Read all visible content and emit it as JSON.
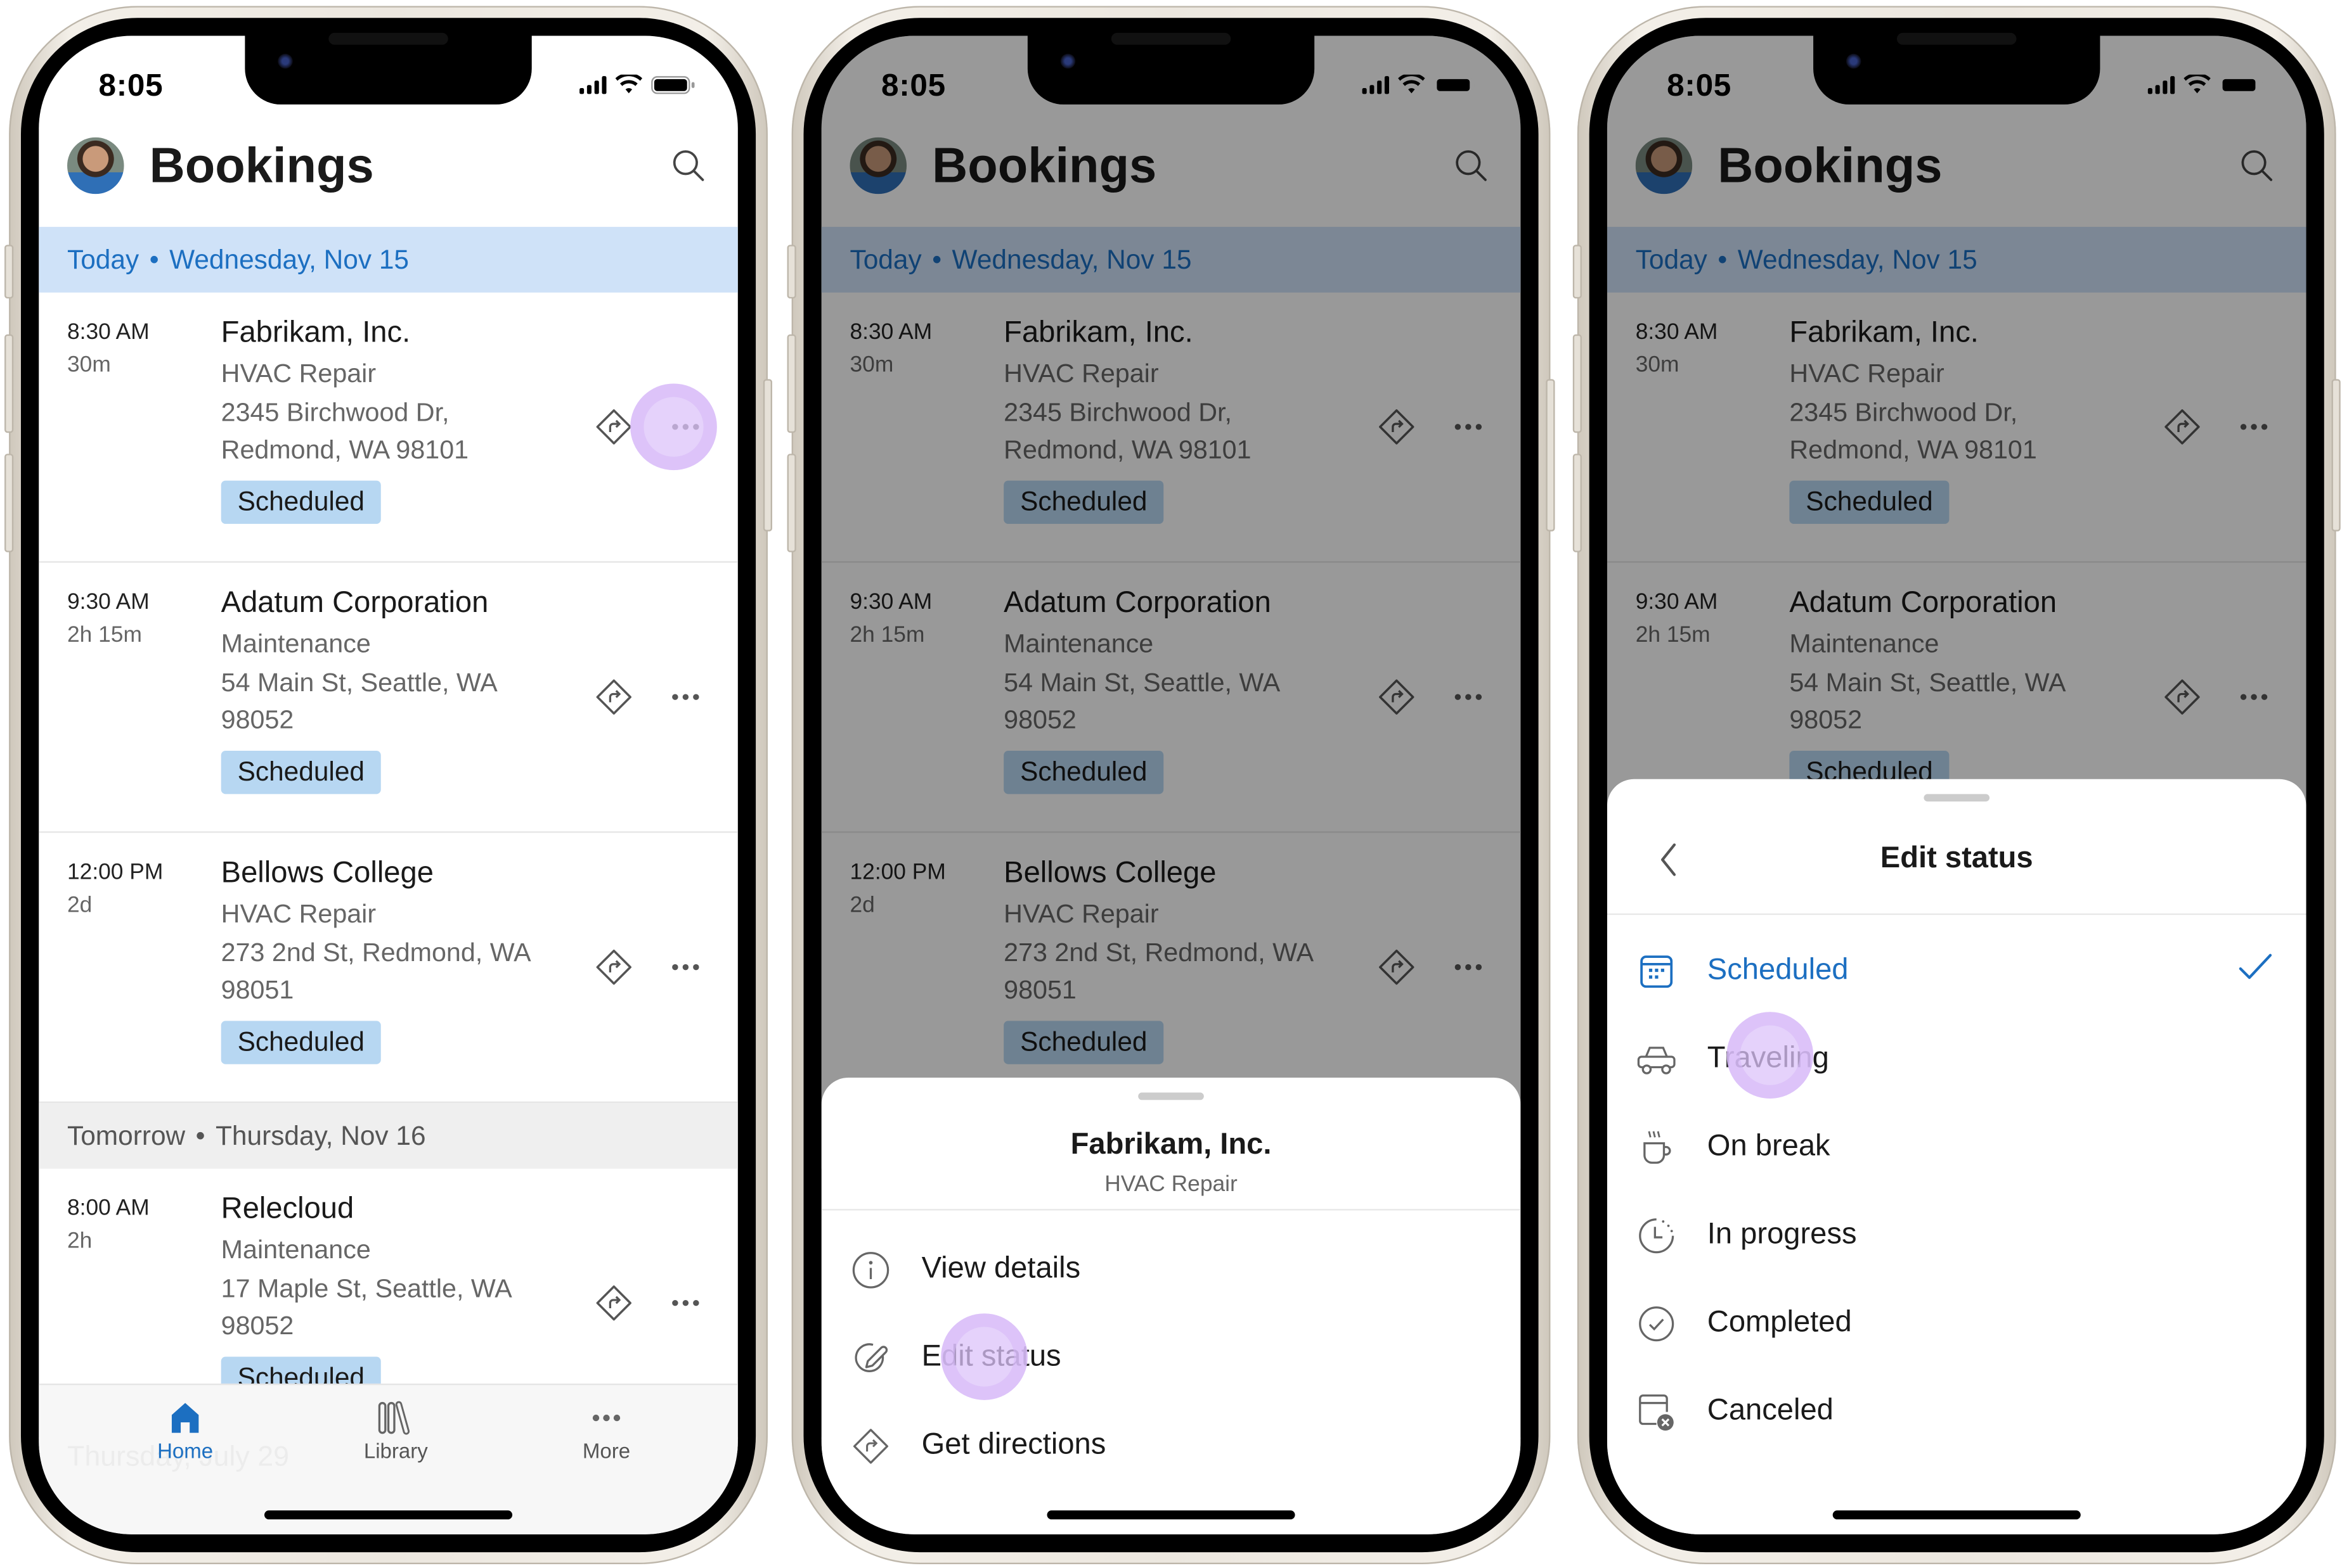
{
  "statusbar": {
    "time": "8:05"
  },
  "app": {
    "title": "Bookings",
    "avatar_alt": "user-avatar"
  },
  "colors": {
    "accent": "#1c6fc1",
    "today_header_bg": "#cfe2f8",
    "badge_bg": "#b7d7f2",
    "tap_highlight": "#e0c8fa"
  },
  "schedule": {
    "today_header": {
      "label": "Today",
      "separator": "•",
      "date": "Wednesday, Nov 15"
    },
    "tomorrow_header": {
      "label": "Tomorrow",
      "separator": "•",
      "date": "Thursday, Nov 16"
    },
    "ghost_header": "Thursday, July 29",
    "appointments": [
      {
        "time": "8:30 AM",
        "duration": "30m",
        "customer": "Fabrikam, Inc.",
        "service": "HVAC Repair",
        "address": "2345 Birchwood Dr, Redmond, WA 98101",
        "status": "Scheduled"
      },
      {
        "time": "9:30 AM",
        "duration": "2h 15m",
        "customer": "Adatum Corporation",
        "service": "Maintenance",
        "address": "54 Main St, Seattle, WA 98052",
        "status": "Scheduled"
      },
      {
        "time": "12:00 PM",
        "duration": "2d",
        "customer": "Bellows College",
        "service": "HVAC Repair",
        "address": "273 2nd St, Redmond, WA 98051",
        "status": "Scheduled"
      },
      {
        "time": "8:00 AM",
        "duration": "2h",
        "customer": "Relecloud",
        "service": "Maintenance",
        "address": "17 Maple St, Seattle, WA 98052",
        "status": "Scheduled"
      }
    ]
  },
  "tabbar": {
    "tabs": [
      {
        "label": "Home",
        "icon": "home-icon",
        "active": true
      },
      {
        "label": "Library",
        "icon": "library-icon",
        "active": false
      },
      {
        "label": "More",
        "icon": "more-icon",
        "active": false
      }
    ]
  },
  "action_sheet": {
    "title": "Fabrikam, Inc.",
    "subtitle": "HVAC Repair",
    "items": [
      {
        "label": "View details",
        "icon": "info-icon"
      },
      {
        "label": "Edit status",
        "icon": "edit-icon"
      },
      {
        "label": "Get directions",
        "icon": "directions-icon"
      }
    ]
  },
  "edit_status_sheet": {
    "title": "Edit status",
    "back_icon": "chevron-left-icon",
    "selected": "Scheduled",
    "options": [
      {
        "label": "Scheduled",
        "icon": "calendar-icon",
        "selected": true
      },
      {
        "label": "Traveling",
        "icon": "car-icon",
        "selected": false
      },
      {
        "label": "On break",
        "icon": "coffee-icon",
        "selected": false
      },
      {
        "label": "In progress",
        "icon": "clock-icon",
        "selected": false
      },
      {
        "label": "Completed",
        "icon": "check-circle-icon",
        "selected": false
      },
      {
        "label": "Canceled",
        "icon": "calendar-cancel-icon",
        "selected": false
      }
    ]
  }
}
